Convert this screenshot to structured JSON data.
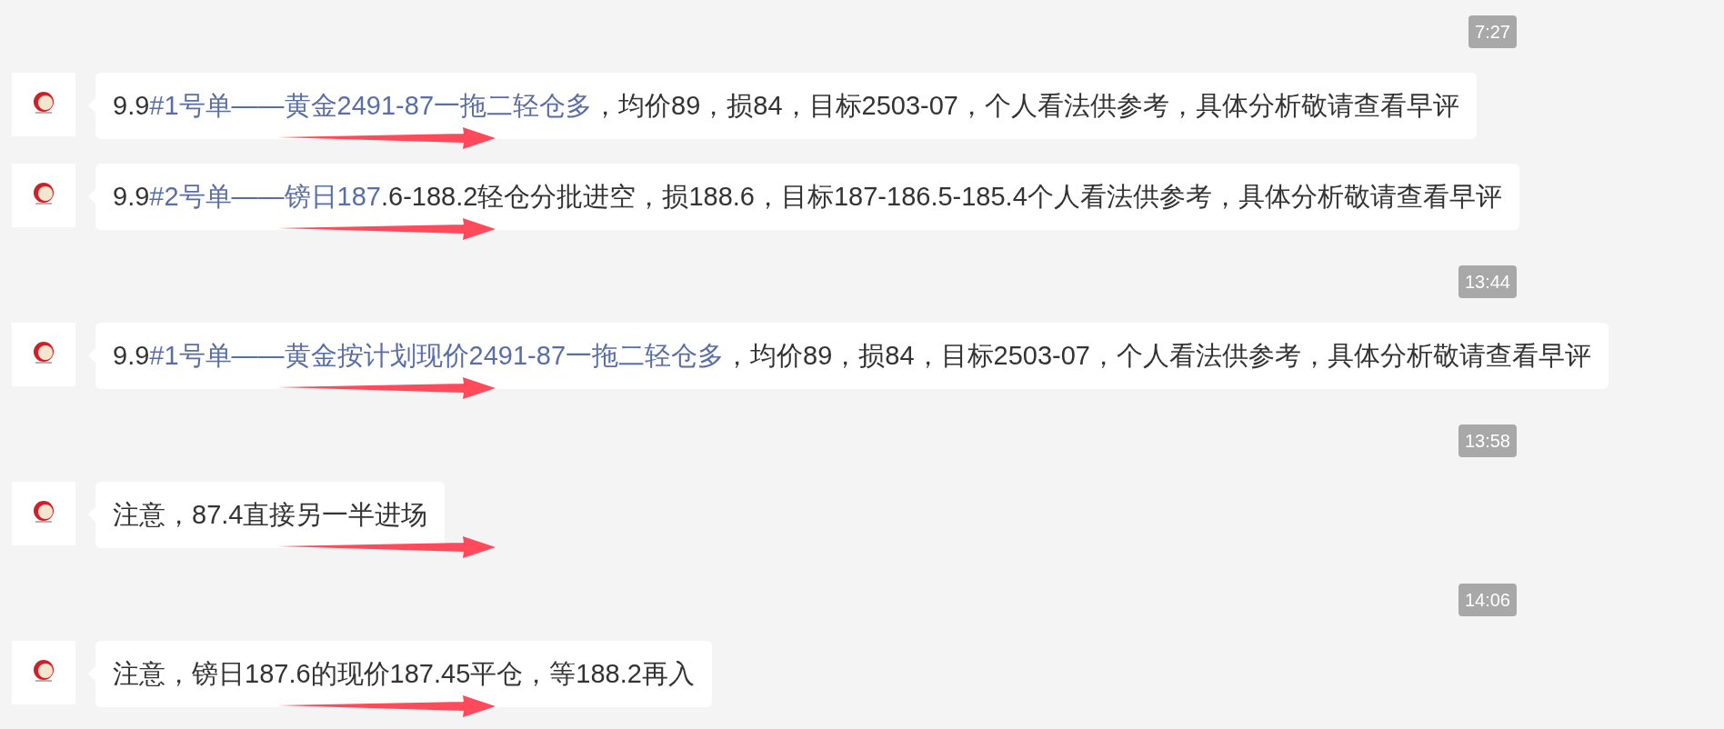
{
  "feed": [
    {
      "kind": "time",
      "text": "7:27"
    },
    {
      "kind": "message",
      "arrow": true,
      "parts": [
        {
          "text": "9.9",
          "link": false
        },
        {
          "text": "#1号单——黄金2491-87一拖二轻仓多",
          "link": true
        },
        {
          "text": "，均价89，损84，目标2503-07，个人看法供参考，具体分析敬请查看早评",
          "link": false
        }
      ]
    },
    {
      "kind": "message",
      "arrow": true,
      "parts": [
        {
          "text": "9.9",
          "link": false
        },
        {
          "text": "#2号单——镑日187",
          "link": true
        },
        {
          "text": ".6-188.2轻仓分批进空，损188.6，目标187-186.5-185.4个人看法供参考，具体分析敬请查看早评",
          "link": false
        }
      ]
    },
    {
      "kind": "time",
      "text": "13:44"
    },
    {
      "kind": "message",
      "arrow": true,
      "parts": [
        {
          "text": "9.9",
          "link": false
        },
        {
          "text": "#1号单——黄金按计划现价2491-87一拖二轻仓多",
          "link": true
        },
        {
          "text": "，均价89，损84，目标2503-07，个人看法供参考，具体分析敬请查看早评",
          "link": false
        }
      ]
    },
    {
      "kind": "time",
      "text": "13:58"
    },
    {
      "kind": "message",
      "arrow": true,
      "parts": [
        {
          "text": "注意，87.4直接另一半进场",
          "link": false
        }
      ]
    },
    {
      "kind": "time",
      "text": "14:06"
    },
    {
      "kind": "message",
      "arrow": true,
      "parts": [
        {
          "text": "注意，镑日187.6的现价187.45平仓，等188.2再入",
          "link": false
        }
      ]
    }
  ]
}
